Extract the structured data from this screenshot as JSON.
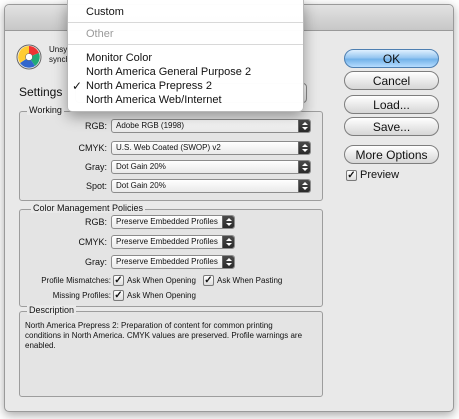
{
  "dialog": {
    "message_line1": "Unsy",
    "message_line2": "synch",
    "settings_label": "Settings",
    "working_spaces_label": "Working",
    "working": [
      {
        "label": "RGB:",
        "value": "Adobe RGB (1998)"
      },
      {
        "label": "CMYK:",
        "value": "U.S. Web Coated (SWOP) v2"
      },
      {
        "label": "Gray:",
        "value": "Dot Gain 20%"
      },
      {
        "label": "Spot:",
        "value": "Dot Gain 20%"
      }
    ],
    "policies_label": "Color Management Policies",
    "policies": [
      {
        "label": "RGB:",
        "value": "Preserve Embedded Profiles"
      },
      {
        "label": "CMYK:",
        "value": "Preserve Embedded Profiles"
      },
      {
        "label": "Gray:",
        "value": "Preserve Embedded Profiles"
      }
    ],
    "profile_mismatches_label": "Profile Mismatches:",
    "ask_when_opening_label": "Ask When Opening",
    "ask_when_pasting_label": "Ask When Pasting",
    "missing_profiles_label": "Missing Profiles:",
    "missing_ask_when_opening_label": "Ask When Opening",
    "description_label": "Description",
    "description_lines": [
      "North America Prepress 2:  Preparation of content for common printing",
      "conditions in North America. CMYK values are preserved. Profile warnings are",
      "enabled."
    ]
  },
  "buttons": {
    "ok": "OK",
    "cancel": "Cancel",
    "load": "Load...",
    "save": "Save...",
    "more_options": "More Options"
  },
  "preview": {
    "label": "Preview",
    "checked": true
  },
  "menu": {
    "custom": "Custom",
    "other": "Other",
    "items": [
      "Monitor Color",
      "North America General Purpose 2",
      "North America Prepress 2",
      "North America Web/Internet"
    ],
    "check_mark": "✓"
  },
  "checkmark": "✓"
}
